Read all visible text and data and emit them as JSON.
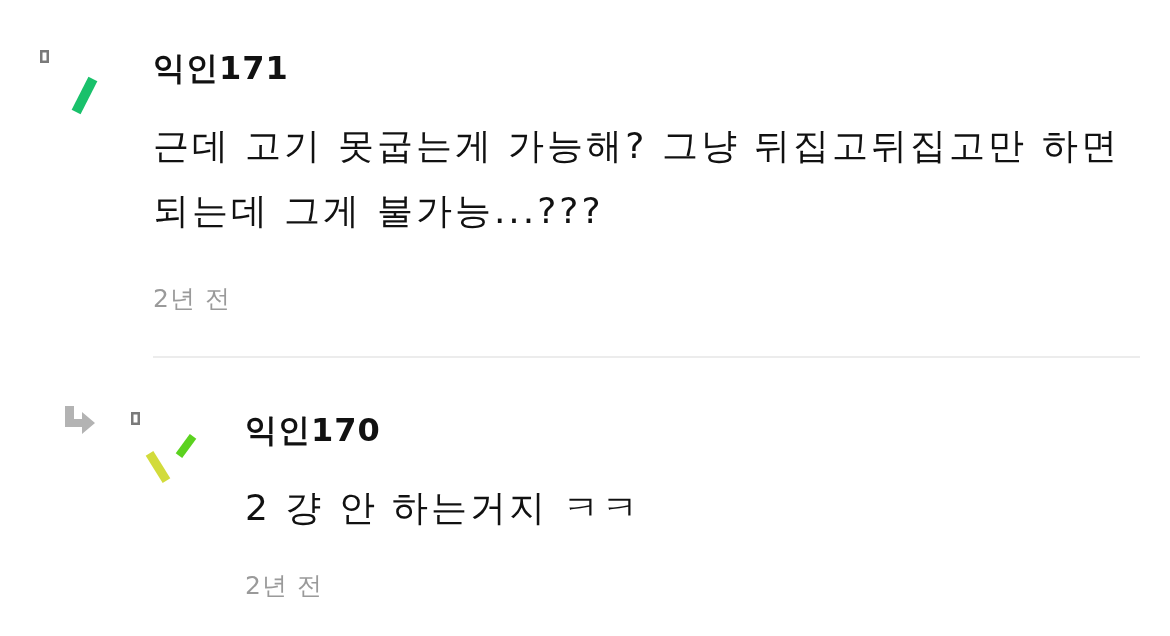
{
  "comments": [
    {
      "kind": "comment",
      "author": "익인171",
      "text": "근데 고기 못굽는게 가능해? 그냥 뒤집고뒤집고만 하면 되는데 그게 불가능...???",
      "time": "2년 전",
      "avatar": [
        {
          "color": "#19c16b"
        }
      ]
    },
    {
      "kind": "reply",
      "author": "익인170",
      "text": "2 걍 안 하는거지 ㅋㅋ",
      "time": "2년 전",
      "avatar": [
        {
          "color": "#d2db3b"
        },
        {
          "color": "#5bd21f"
        }
      ]
    }
  ]
}
